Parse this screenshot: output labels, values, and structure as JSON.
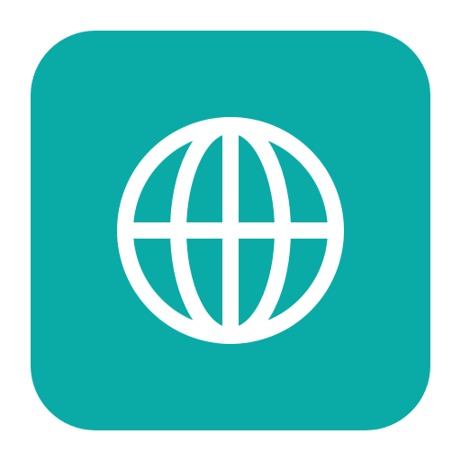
{
  "app_icon": {
    "icon": "globe-icon",
    "background_color": "#0AABA7",
    "glyph_color": "#FFFFFF"
  }
}
